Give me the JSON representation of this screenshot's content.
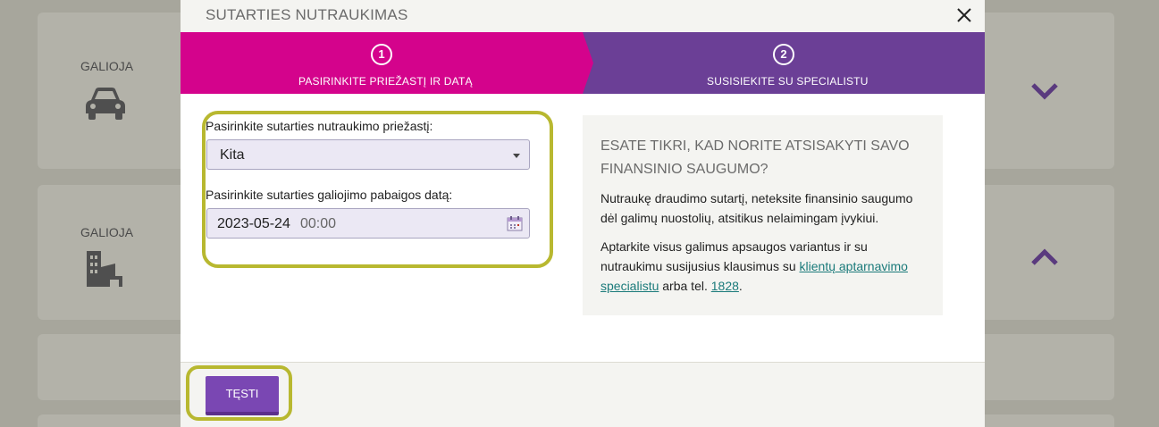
{
  "background": {
    "cards": [
      {
        "status": "GALIOJA",
        "icon": "car-icon",
        "expanded": false
      },
      {
        "status": "GALIOJA",
        "icon": "building-icon",
        "expanded": true
      }
    ]
  },
  "modal": {
    "title": "SUTARTIES NUTRAUKIMAS",
    "steps": [
      {
        "number": "1",
        "label": "PASIRINKITE PRIEŽASTĮ IR DATĄ",
        "active": true
      },
      {
        "number": "2",
        "label": "SUSISIEKITE SU SPECIALISTU",
        "active": false
      }
    ],
    "form": {
      "reason_label": "Pasirinkite sutarties nutraukimo priežastį:",
      "reason_value": "Kita",
      "date_label": "Pasirinkite sutarties galiojimo pabaigos datą:",
      "date_value": "2023-05-24",
      "time_value": "00:00"
    },
    "info": {
      "heading": "ESATE TIKRI, KAD NORITE ATSISAKYTI SAVO FINANSINIO SAUGUMO?",
      "paragraph1": "Nutraukę draudimo sutartį, neteksite finansinio saugumo dėl galimų nuostolių, atsitikus nelaimingam įvykiui.",
      "paragraph2_prefix": "Aptarkite visus galimus apsaugos variantus ir su nutraukimu susijusius klausimus su ",
      "specialist_link": "klientų aptarnavimo specialistu",
      "paragraph2_mid": " arba tel. ",
      "phone_link": "1828",
      "paragraph2_suffix": "."
    },
    "footer": {
      "continue_label": "TĘSTI"
    }
  },
  "colors": {
    "step_active": "#d4038c",
    "step_inactive": "#6b3f96",
    "button": "#7a47b3",
    "highlight": "#b8b830",
    "link": "#1a7a7a"
  }
}
